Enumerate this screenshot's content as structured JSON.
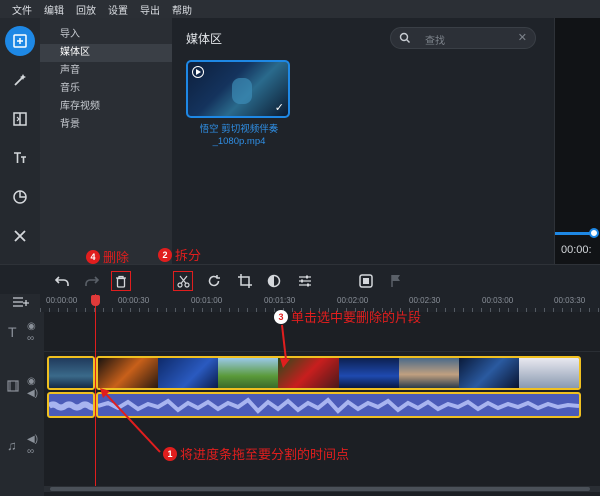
{
  "menu": [
    "文件",
    "编辑",
    "回放",
    "设置",
    "导出",
    "帮助"
  ],
  "tools": [
    {
      "name": "import-icon",
      "glyph": "+",
      "active": true
    },
    {
      "name": "magic-wand-icon",
      "glyph": "✦"
    },
    {
      "name": "transitions-icon",
      "glyph": "◧"
    },
    {
      "name": "titles-icon",
      "glyph": "Tт"
    },
    {
      "name": "stickers-icon",
      "glyph": "◔"
    },
    {
      "name": "more-tools-icon",
      "glyph": "✕"
    }
  ],
  "categories": [
    "导入",
    "媒体区",
    "声音",
    "音乐",
    "库存视频",
    "背景"
  ],
  "selected_category": 1,
  "media": {
    "title": "媒体区",
    "search_placeholder": "查找",
    "thumbnail_name": "悟空  剪切视频伴奏\n_1080p.mp4"
  },
  "preview": {
    "time": "00:00:"
  },
  "annotations": {
    "delete": {
      "num": "4",
      "text": "删除"
    },
    "split": {
      "num": "2",
      "text": "拆分"
    },
    "select": {
      "num": "3",
      "text": "单击选中要删除的片段"
    },
    "drag": {
      "num": "1",
      "text": "将进度条拖至要分割的时间点"
    }
  },
  "ruler": [
    "00:00:00",
    "00:00:30",
    "00:01:00",
    "00:01:30",
    "00:02:00",
    "00:02:30",
    "00:03:00",
    "00:03:30"
  ],
  "colors": {
    "accent": "#1e88e5",
    "annotation": "#e01e1e",
    "clip_border": "#f0c020",
    "audio": "#4b5bb8"
  }
}
